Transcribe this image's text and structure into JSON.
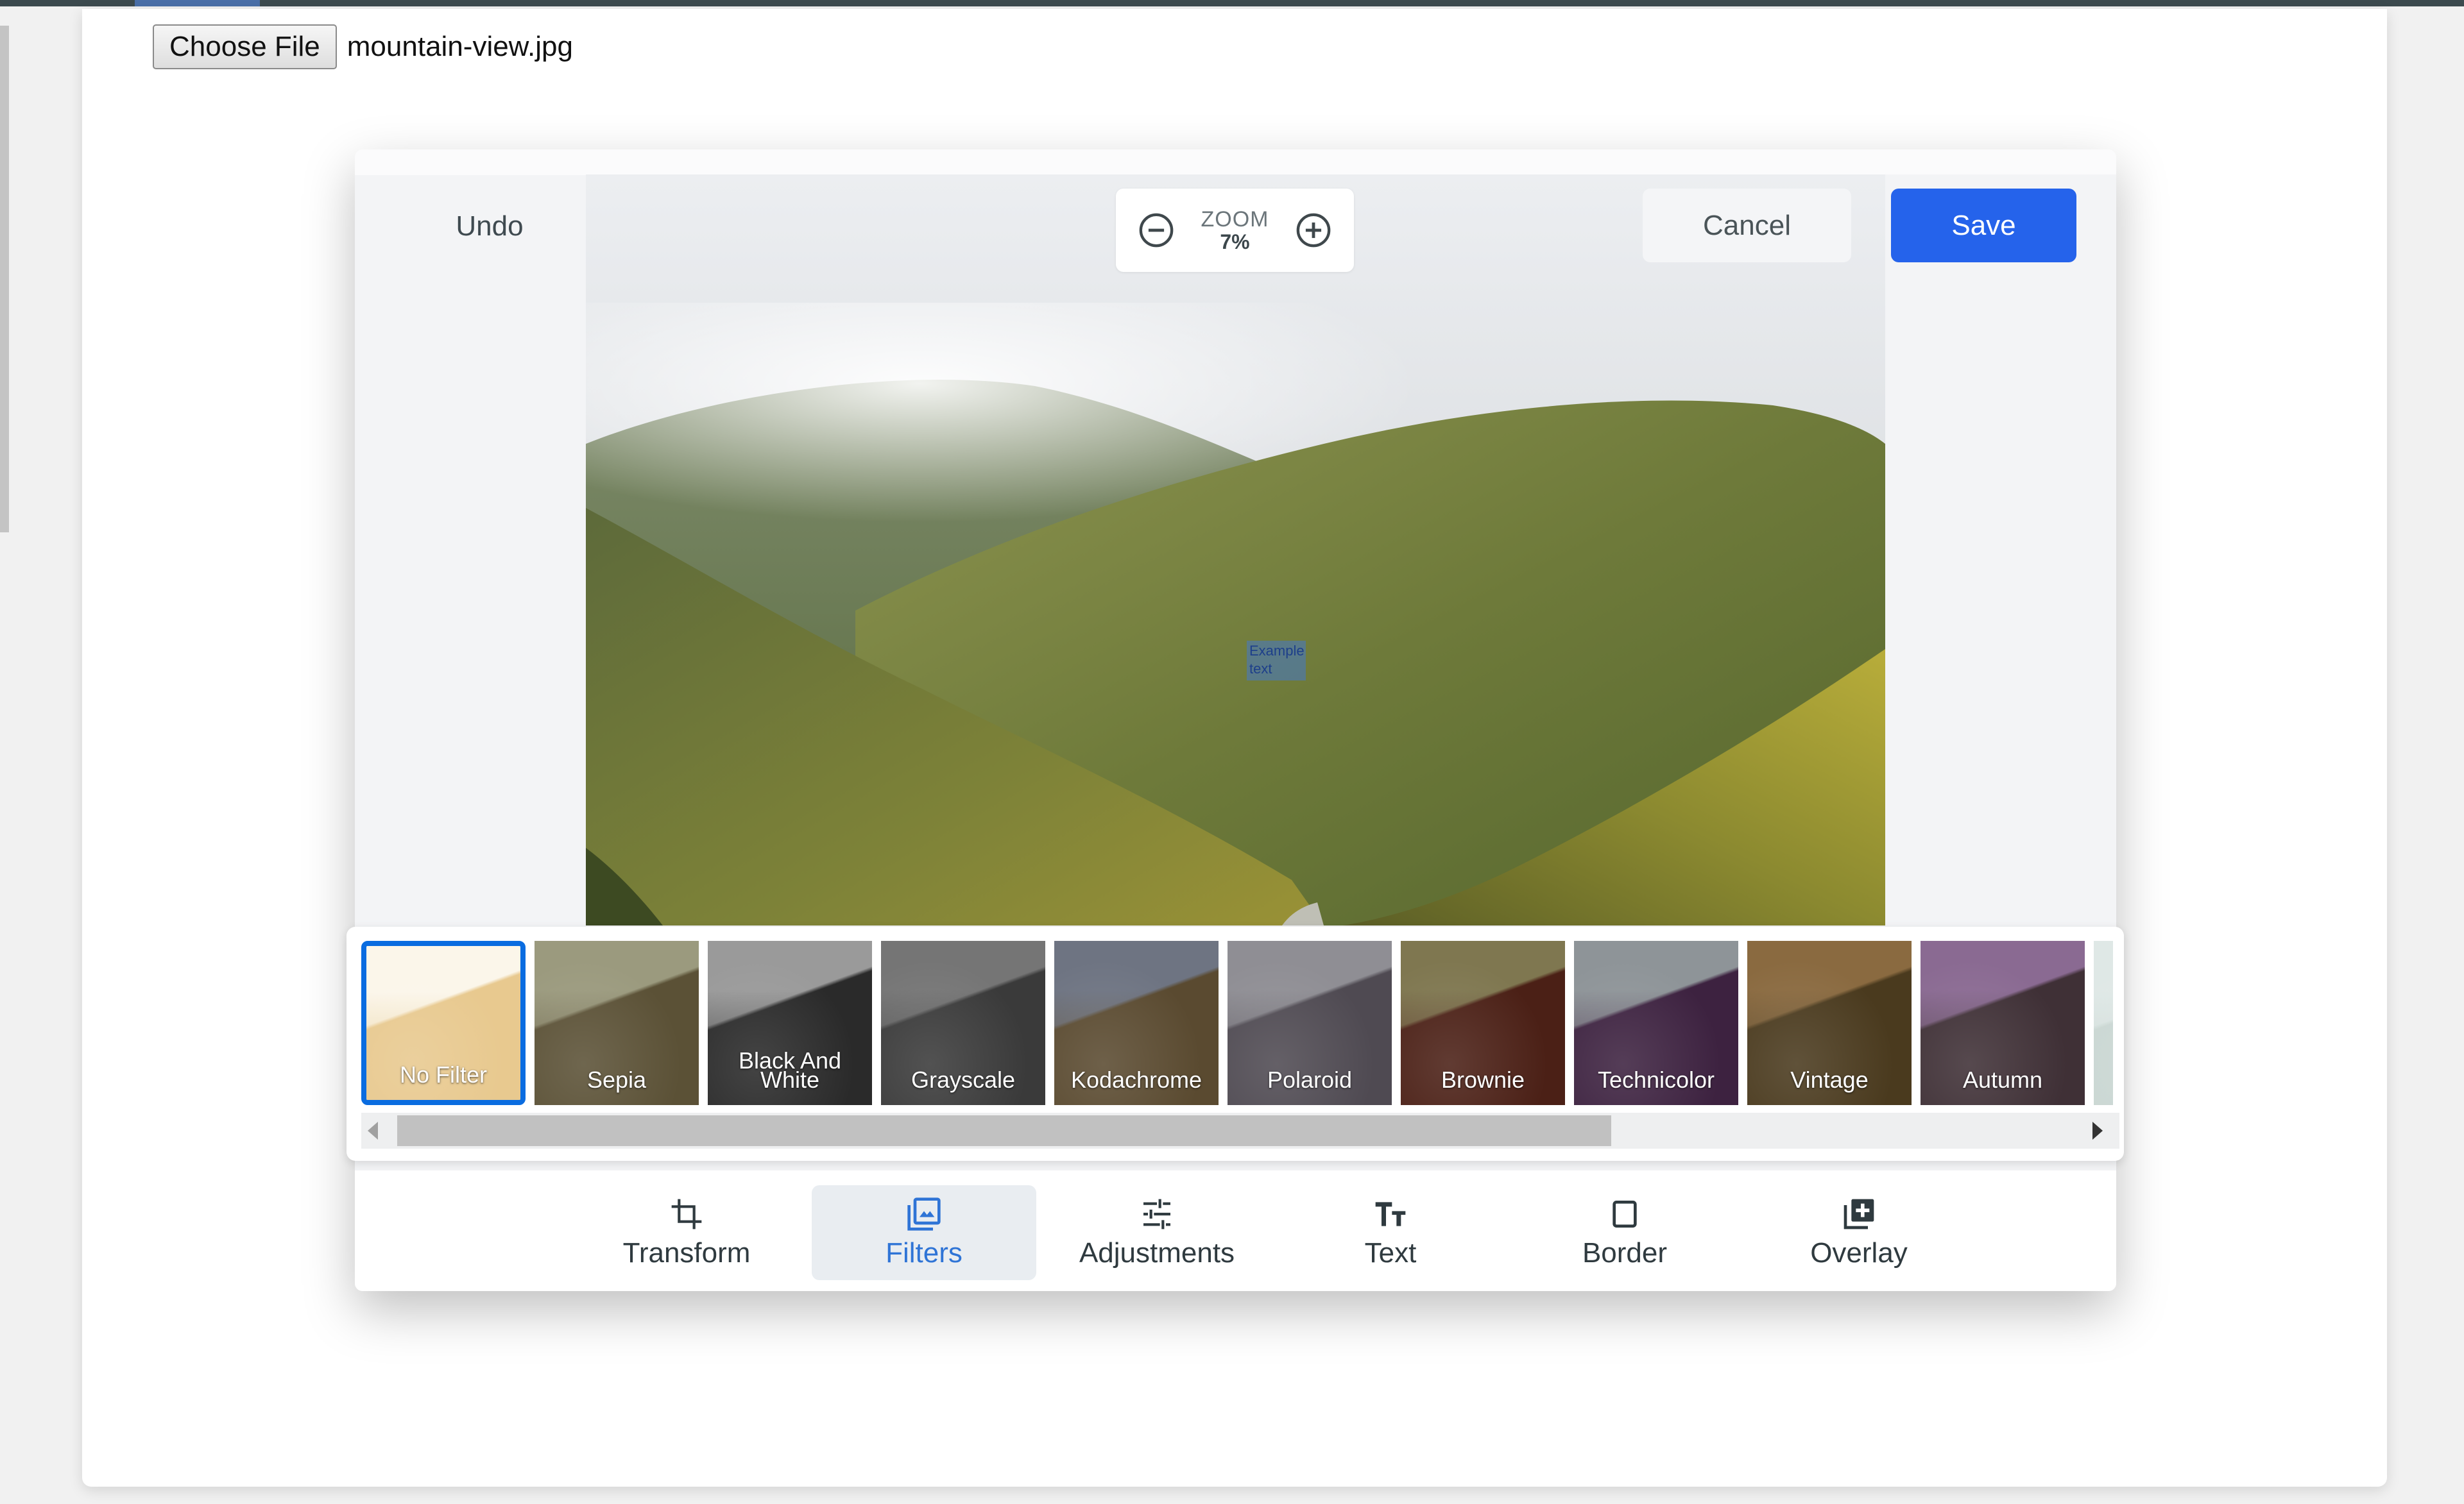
{
  "browser": {
    "active_tab_indicator": true
  },
  "file_input": {
    "button_label": "Choose File",
    "file_name": "mountain-view.jpg"
  },
  "editor": {
    "undo_label": "Undo",
    "zoom": {
      "label": "ZOOM",
      "value": "7%"
    },
    "cancel_label": "Cancel",
    "save_label": "Save",
    "overlay_text": "Example text",
    "colors": {
      "accent": "#2563eb",
      "selected_border": "#0a6ce0",
      "active_tab_text": "#2f74d6"
    }
  },
  "filters": {
    "selected": "No Filter",
    "items": [
      {
        "label": "No Filter",
        "tint": "#e8c98f",
        "sky": "#fbf6ea"
      },
      {
        "label": "Sepia",
        "tint": "#5b5136",
        "sky": "#9b9a7e"
      },
      {
        "label": "Black And White",
        "tint": "#2a2a2a",
        "sky": "#9a9a9a"
      },
      {
        "label": "Grayscale",
        "tint": "#3a3a3a",
        "sky": "#757575"
      },
      {
        "label": "Kodachrome",
        "tint": "#5a4a30",
        "sky": "#6e7482"
      },
      {
        "label": "Polaroid",
        "tint": "#4f4a52",
        "sky": "#8f8e94"
      },
      {
        "label": "Brownie",
        "tint": "#4b2016",
        "sky": "#7f7750"
      },
      {
        "label": "Technicolor",
        "tint": "#3d2240",
        "sky": "#8e9498"
      },
      {
        "label": "Vintage",
        "tint": "#4a3a1e",
        "sky": "#8a6a40"
      },
      {
        "label": "Autumn",
        "tint": "#3f3036",
        "sky": "#8a6a92"
      },
      {
        "label": "",
        "tint": "#c9d6d2",
        "sky": "#dfe8e6"
      }
    ],
    "scroll_position": 0.0,
    "scroll_visible_fraction": 0.72
  },
  "tabs": [
    {
      "label": "Transform",
      "icon": "crop-icon",
      "active": false
    },
    {
      "label": "Filters",
      "icon": "filters-icon",
      "active": true
    },
    {
      "label": "Adjustments",
      "icon": "sliders-icon",
      "active": false
    },
    {
      "label": "Text",
      "icon": "text-icon",
      "active": false
    },
    {
      "label": "Border",
      "icon": "border-icon",
      "active": false
    },
    {
      "label": "Overlay",
      "icon": "overlay-icon",
      "active": false
    }
  ]
}
